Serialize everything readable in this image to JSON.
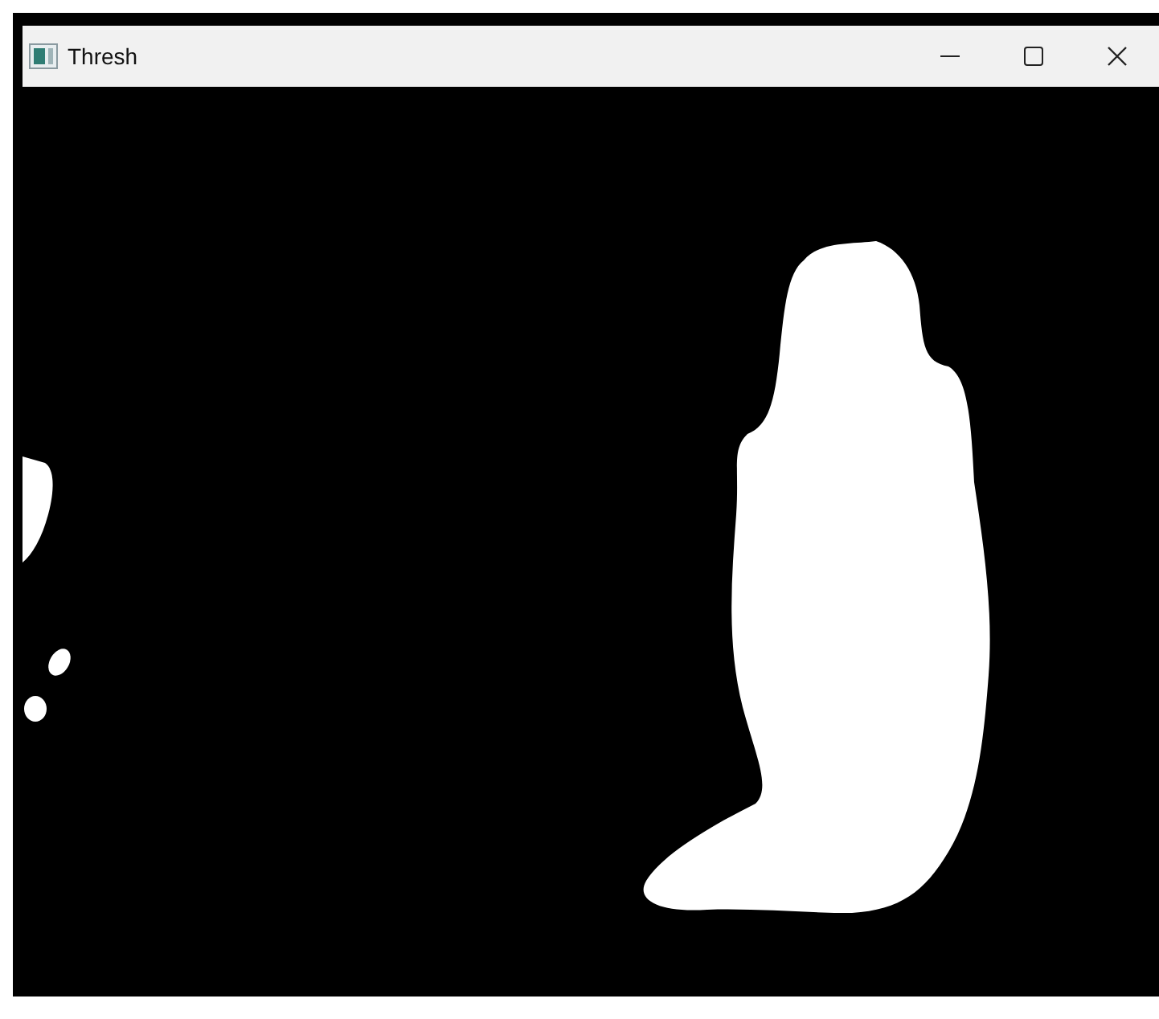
{
  "window": {
    "title": "Thresh"
  }
}
